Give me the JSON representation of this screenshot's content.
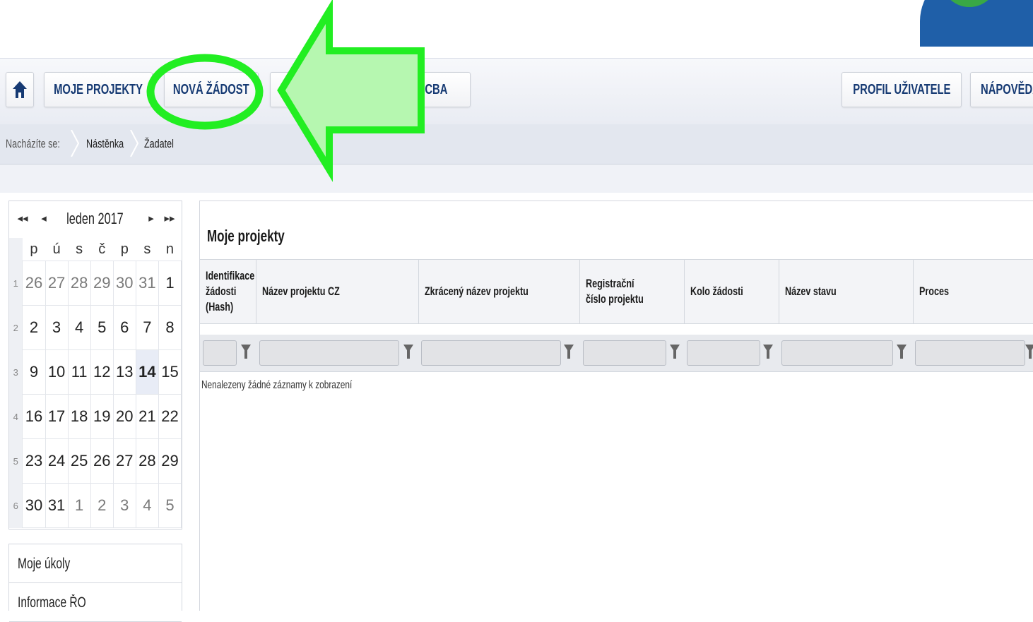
{
  "nav": {
    "moje_projekty": "MOJE PROJEKTY",
    "nova_zadost": "NOVÁ ŽÁDOST",
    "modul_cba_partial": "UL CBA",
    "profil": "PROFIL UŽIVATELE",
    "napoveda": "NÁPOVĚDA"
  },
  "breadcrumb": {
    "label": "Nacházíte se:",
    "items": [
      "Nástěnka",
      "Žadatel"
    ]
  },
  "calendar": {
    "title": "leden 2017",
    "weekdays": [
      "p",
      "ú",
      "s",
      "č",
      "p",
      "s",
      "n"
    ],
    "weeks": [
      {
        "num": "1",
        "days": [
          "26",
          "27",
          "28",
          "29",
          "30",
          "31",
          "1"
        ]
      },
      {
        "num": "2",
        "days": [
          "2",
          "3",
          "4",
          "5",
          "6",
          "7",
          "8"
        ]
      },
      {
        "num": "3",
        "days": [
          "9",
          "10",
          "11",
          "12",
          "13",
          "14",
          "15"
        ]
      },
      {
        "num": "4",
        "days": [
          "16",
          "17",
          "18",
          "19",
          "20",
          "21",
          "22"
        ]
      },
      {
        "num": "5",
        "days": [
          "23",
          "24",
          "25",
          "26",
          "27",
          "28",
          "29"
        ]
      },
      {
        "num": "6",
        "days": [
          "30",
          "31",
          "1",
          "2",
          "3",
          "4",
          "5"
        ]
      }
    ],
    "today": "14"
  },
  "side_menu": [
    "Moje úkoly",
    "Informace ŘO"
  ],
  "projects": {
    "title": "Moje projekty",
    "columns": [
      "Identifikace žádosti (Hash)",
      "Název projektu CZ",
      "Zkrácený název projektu",
      "Registrační číslo projektu",
      "Kolo žádosti",
      "Název stavu",
      "Proces"
    ],
    "empty": "Nenalezeny žádné záznamy k zobrazení"
  },
  "colors": {
    "nav_text": "#163a73",
    "highlight_green": "#22ee22",
    "arrow_fill": "#b6f7b0",
    "logo_blue": "#1f5fa8",
    "logo_green": "#39a845"
  },
  "icons": [
    "home-icon",
    "first-page-icon",
    "prev-page-icon",
    "next-page-icon",
    "last-page-icon",
    "filter-icon"
  ]
}
